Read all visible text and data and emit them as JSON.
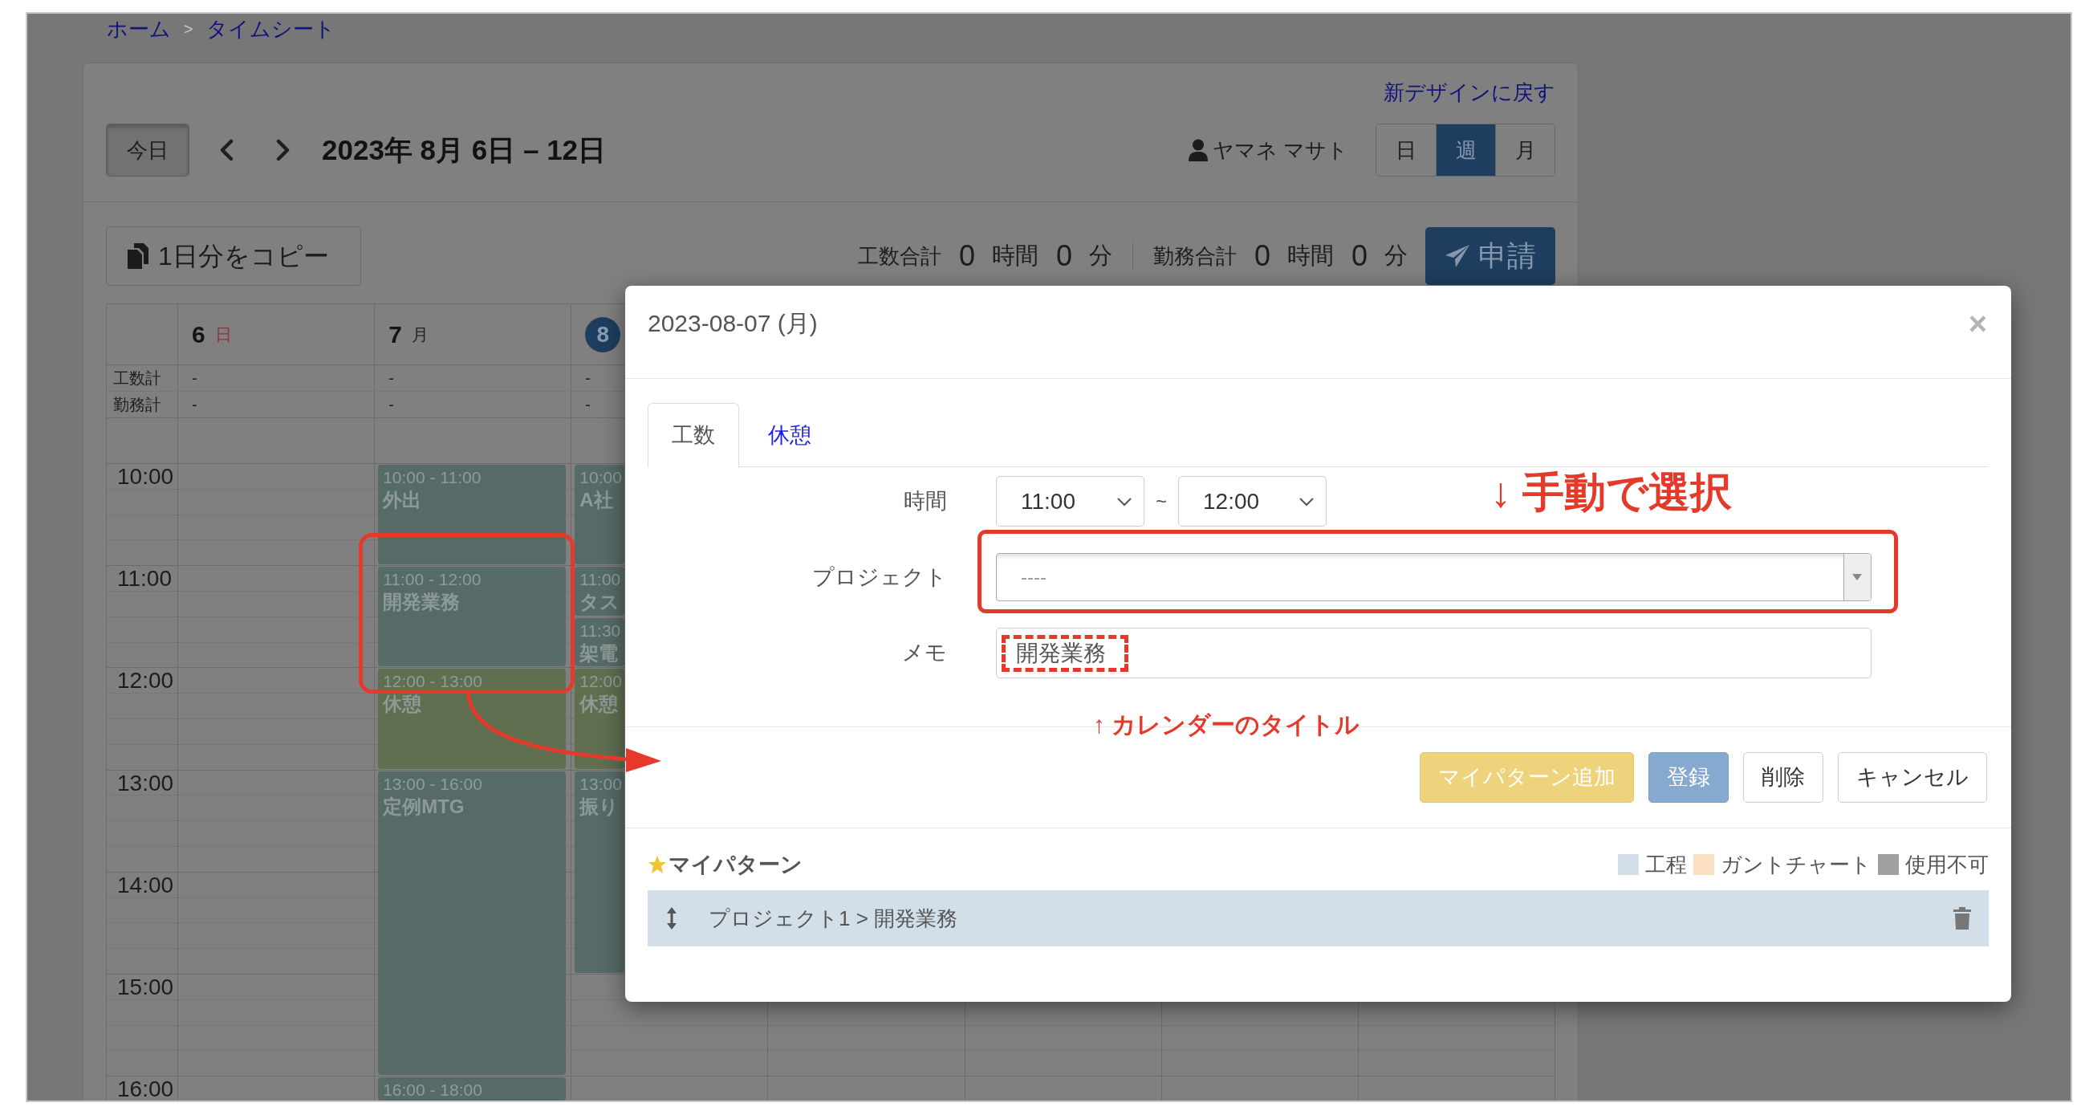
{
  "breadcrumb": {
    "items": [
      {
        "label": "ホーム"
      },
      {
        "label": "タイムシート"
      }
    ],
    "separator": ">"
  },
  "header": {
    "new_design_link": "新デザインに戻す",
    "today_button": "今日",
    "date_range": "2023年 8月 6日 – 12日",
    "user_name": "ヤマネ マサト",
    "views": [
      {
        "label": "日",
        "selected": false
      },
      {
        "label": "週",
        "selected": true
      },
      {
        "label": "月",
        "selected": false
      }
    ]
  },
  "toolbar": {
    "copy_button": "1日分をコピー",
    "totals": [
      {
        "label": "工数合計",
        "hours": "0",
        "hours_unit": "時間",
        "minutes": "0",
        "minutes_unit": "分"
      },
      {
        "label": "勤務合計",
        "hours": "0",
        "hours_unit": "時間",
        "minutes": "0",
        "minutes_unit": "分"
      }
    ],
    "submit_button": "申請"
  },
  "calendar": {
    "row_labels": [
      "工数計",
      "勤務計"
    ],
    "hours": [
      "10:00",
      "11:00",
      "12:00",
      "13:00",
      "14:00",
      "15:00",
      "16:00"
    ],
    "days": [
      {
        "date": "6",
        "weekday": "日",
        "holiday": true,
        "today": false,
        "totals": [
          "-",
          "-"
        ]
      },
      {
        "date": "7",
        "weekday": "月",
        "holiday": false,
        "today": false,
        "totals": [
          "-",
          "-"
        ],
        "events": [
          {
            "time": "10:00 - 11:00",
            "title": "外出",
            "kind": "work"
          },
          {
            "time": "11:00 - 12:00",
            "title": "開発業務",
            "kind": "work"
          },
          {
            "time": "12:00 - 13:00",
            "title": "休憩",
            "kind": "break"
          },
          {
            "time": "13:00 - 16:00",
            "title": "定例MTG",
            "kind": "work"
          },
          {
            "time": "16:00 - 18:00",
            "kind": "work"
          }
        ]
      },
      {
        "date": "8",
        "today": true,
        "totals": [
          "-",
          "-"
        ],
        "events": [
          {
            "time": "10:00",
            "title": "A社",
            "kind": "work"
          },
          {
            "time": "11:00",
            "title": "タス",
            "kind": "work"
          },
          {
            "time": "11:30",
            "title": "架電",
            "kind": "work"
          },
          {
            "time": "12:00",
            "title": "休憩",
            "kind": "break"
          },
          {
            "time": "13:00",
            "title": "振り",
            "kind": "work"
          }
        ]
      }
    ]
  },
  "dialog": {
    "title": "2023-08-07 (月)",
    "close": "×",
    "tabs": [
      {
        "label": "工数",
        "selected": true
      },
      {
        "label": "休憩",
        "selected": false
      }
    ],
    "time": {
      "label": "時間",
      "from": "11:00",
      "separator": "~",
      "to": "12:00"
    },
    "project": {
      "label": "プロジェクト",
      "placeholder": "----"
    },
    "memo": {
      "label": "メモ",
      "value": "開発業務"
    },
    "buttons": [
      {
        "label": "マイパターン追加",
        "kind": "warning"
      },
      {
        "label": "登録",
        "kind": "primary"
      },
      {
        "label": "削除",
        "kind": "default"
      },
      {
        "label": "キャンセル",
        "kind": "default"
      }
    ],
    "my_patterns": {
      "title": "マイパターン",
      "legend": [
        {
          "label": "工程",
          "color": "#d2dfea"
        },
        {
          "label": "ガントチャート",
          "color": "#fbe0c2"
        },
        {
          "label": "使用不可",
          "color": "#a0a0a0"
        }
      ],
      "items": [
        {
          "label": "プロジェクト1 > 開発業務",
          "color": "#d2dee8"
        }
      ]
    }
  },
  "annotations": {
    "select_note": "↓ 手動で選択",
    "title_note": "↑ カレンダーのタイトル"
  }
}
